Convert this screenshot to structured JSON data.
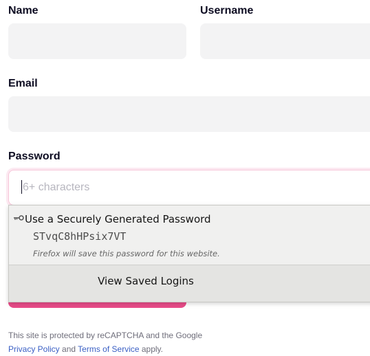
{
  "form": {
    "name_label": "Name",
    "username_label": "Username",
    "email_label": "Email",
    "password_label": "Password",
    "password_placeholder": "6+ characters"
  },
  "autofill_popup": {
    "icon": "key-icon",
    "title": "Use a Securely Generated Password",
    "generated_password": "STvqC8hHPsix7VT",
    "note": "Firefox will save this password for this website.",
    "footer_label": "View Saved Logins"
  },
  "recaptcha": {
    "text_before": "This site is protected by reCAPTCHA and the Google",
    "privacy_link": "Privacy Policy",
    "and_text": " and ",
    "terms_link": "Terms of Service",
    "apply_text": " apply."
  },
  "colors": {
    "accent": "#ea4c89",
    "input_bg": "#f3f3f4",
    "link": "#3a5fc4"
  }
}
